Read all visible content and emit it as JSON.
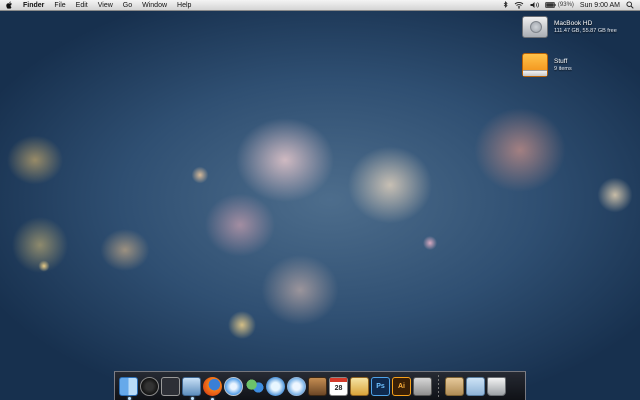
{
  "menubar": {
    "app_name": "Finder",
    "menus": [
      "File",
      "Edit",
      "View",
      "Go",
      "Window",
      "Help"
    ],
    "battery_text": "(93%)",
    "clock": "Sun 9:00 AM"
  },
  "desktop": {
    "items": [
      {
        "name": "MacBook HD",
        "sub": "111.47 GB, 55.87 GB free",
        "icon": "hard-drive-icon"
      },
      {
        "name": "Stuff",
        "sub": "9 items",
        "icon": "external-drive-icon"
      }
    ]
  },
  "dock": {
    "apps": [
      {
        "name": "finder",
        "icon": "finder-icon",
        "running": true
      },
      {
        "name": "dashboard",
        "icon": "dashboard-icon",
        "running": false
      },
      {
        "name": "expose",
        "icon": "expose-icon",
        "running": false
      },
      {
        "name": "preview",
        "icon": "preview-icon",
        "running": true
      },
      {
        "name": "firefox",
        "icon": "firefox-icon",
        "running": true
      },
      {
        "name": "safari",
        "icon": "safari-icon",
        "running": false
      },
      {
        "name": "ichat",
        "icon": "ichat-icon",
        "running": false
      },
      {
        "name": "facetime",
        "icon": "facetime-icon",
        "running": false
      },
      {
        "name": "itunes",
        "icon": "itunes-icon",
        "running": false
      },
      {
        "name": "iphoto",
        "icon": "iphoto-icon",
        "running": false
      },
      {
        "name": "ical",
        "icon": "ical-icon",
        "label": "28",
        "running": false
      },
      {
        "name": "sketch",
        "icon": "sketch-icon",
        "running": false
      },
      {
        "name": "photoshop",
        "icon": "photoshop-icon",
        "label": "Ps",
        "running": false
      },
      {
        "name": "illustrator",
        "icon": "illustrator-icon",
        "label": "Ai",
        "running": false
      },
      {
        "name": "system-preferences",
        "icon": "system-preferences-icon",
        "running": false
      }
    ],
    "stacks": [
      {
        "name": "applications-stack",
        "icon": "applications-folder-icon"
      },
      {
        "name": "documents-stack",
        "icon": "documents-folder-icon"
      },
      {
        "name": "trash",
        "icon": "trash-icon"
      }
    ]
  }
}
